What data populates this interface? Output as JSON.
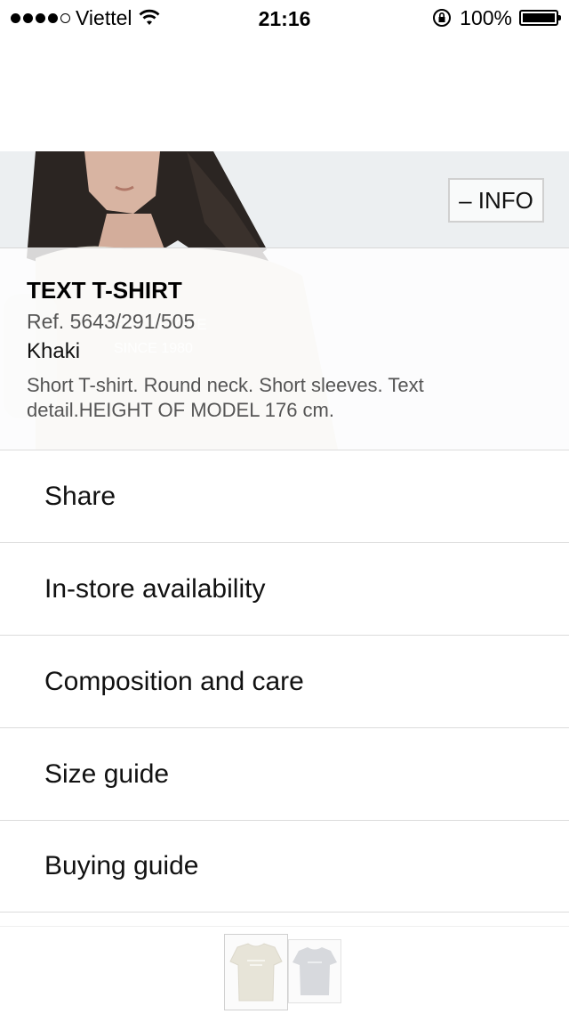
{
  "status_bar": {
    "carrier": "Viettel",
    "time": "21:16",
    "battery": "100%",
    "battery_level": 1.0,
    "signal_bars": 4
  },
  "hero": {
    "info_button_label": "– INFO"
  },
  "product": {
    "title": "TEXT T-SHIRT",
    "ref": "Ref. 5643/291/505",
    "color": "Khaki",
    "description": "Short T-shirt. Round neck. Short sleeves. Text detail.HEIGHT OF MODEL 176 cm."
  },
  "menu": {
    "items": [
      {
        "label": "Share"
      },
      {
        "label": "In-store availability"
      },
      {
        "label": "Composition and care"
      },
      {
        "label": "Size guide"
      },
      {
        "label": "Buying guide"
      }
    ]
  },
  "thumbnails": [
    {
      "icon": "khaki-tshirt-thumbnail"
    },
    {
      "icon": "grey-tshirt-thumbnail"
    }
  ]
}
